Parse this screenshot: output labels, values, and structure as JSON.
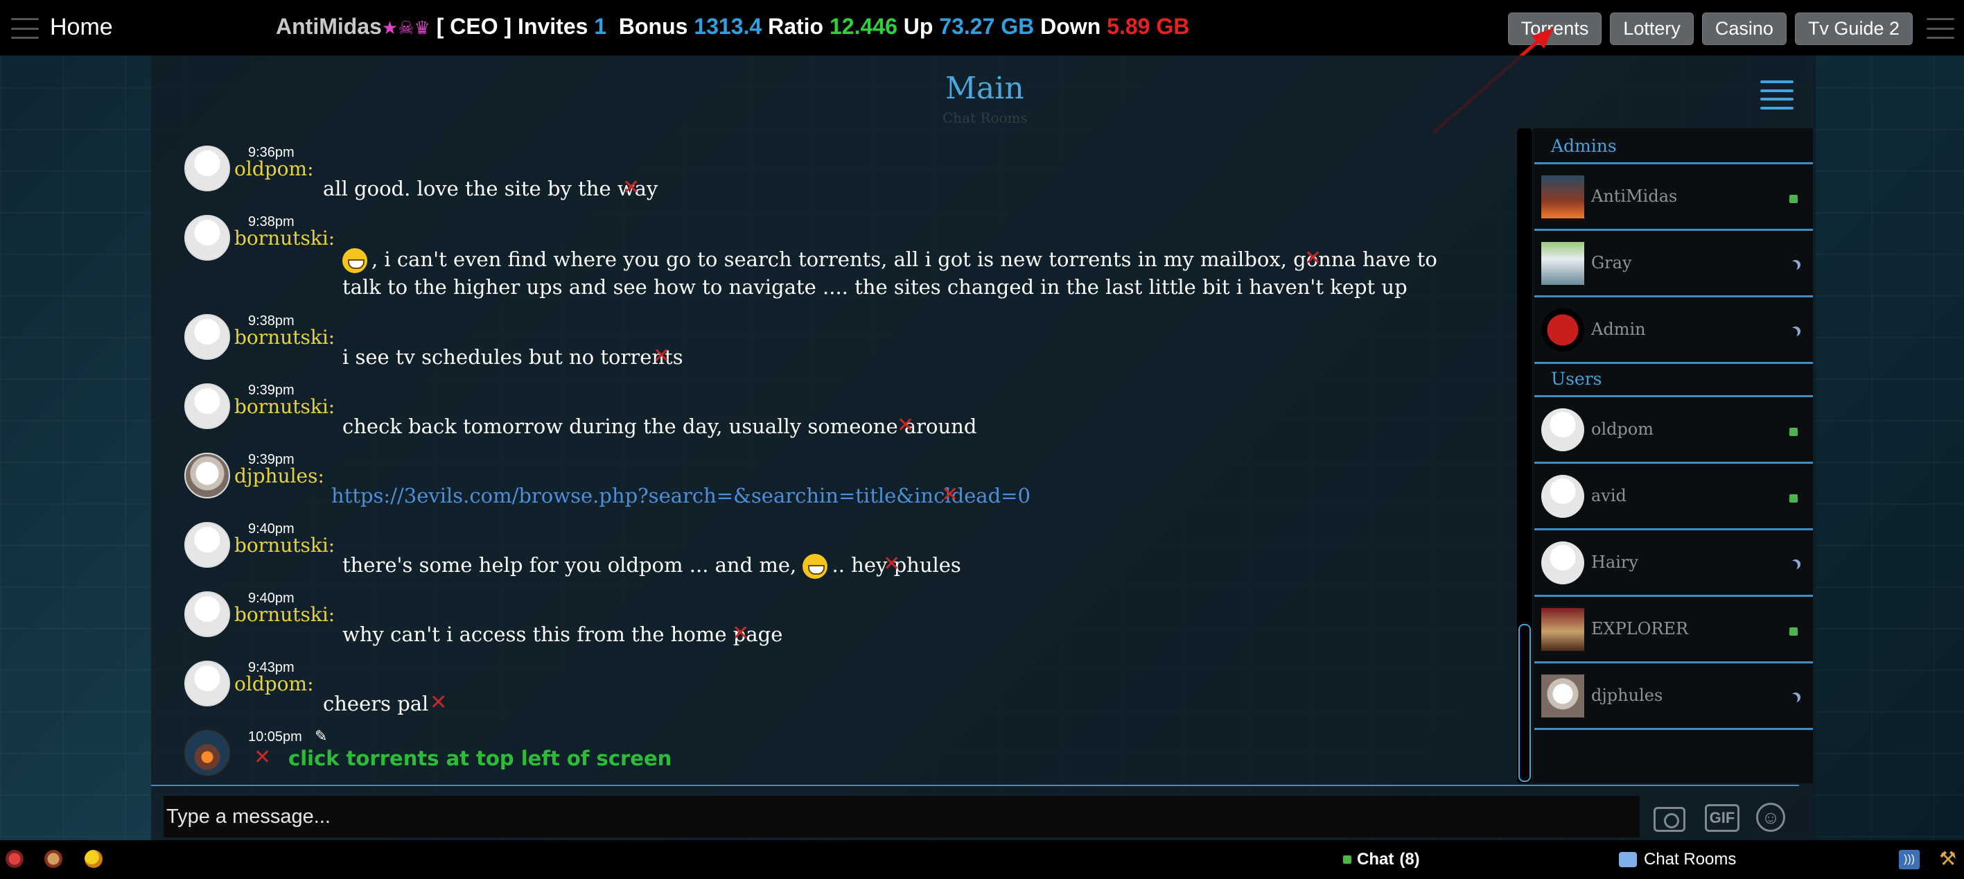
{
  "topbar": {
    "home_label": "Home",
    "username": "AntiMidas",
    "user_icons": "★☠♛",
    "class": "[ CEO ]",
    "invites_label": "Invites",
    "invites_value": "1",
    "bonus_label": "Bonus",
    "bonus_value": "1313.4",
    "ratio_label": "Ratio",
    "ratio_value": "12.446",
    "up_label": "Up",
    "up_value": "73.27 GB",
    "down_label": "Down",
    "down_value": "5.89 GB",
    "buttons": [
      "Torrents",
      "Lottery",
      "Casino",
      "Tv Guide 2"
    ]
  },
  "room": {
    "title": "Main",
    "subtitle": "Chat Rooms"
  },
  "messages": [
    {
      "time": "9:36pm",
      "user": "oldpom:",
      "text": "all good. love the site by the way"
    },
    {
      "time": "9:38pm",
      "user": "bornutski:",
      "text_line1": ", i can't even find where you go to search torrents, all i got is new torrents in my mailbox, gonna have to",
      "text_line2": "talk to the higher ups and see how to navigate .... the sites changed in the last little bit i haven't kept up"
    },
    {
      "time": "9:38pm",
      "user": "bornutski:",
      "text": "i see tv schedules but no torrents"
    },
    {
      "time": "9:39pm",
      "user": "bornutski:",
      "text": "check back tomorrow during the day, usually someone around"
    },
    {
      "time": "9:39pm",
      "user": "djphules:",
      "text": "https://3evils.com/browse.php?search=&searchin=title&incldead=0"
    },
    {
      "time": "9:40pm",
      "user": "bornutski:",
      "text_before": "there's some help for you oldpom ... and me,",
      "text_after": ".. hey phules"
    },
    {
      "time": "9:40pm",
      "user": "bornutski:",
      "text": "why can't i access this from the home page"
    },
    {
      "time": "9:43pm",
      "user": "oldpom:",
      "text": "cheers pal"
    },
    {
      "time": "10:05pm",
      "user": "",
      "text": "click torrents at top left of screen"
    }
  ],
  "sidebar": {
    "admins_heading": "Admins",
    "users_heading": "Users",
    "admins": [
      {
        "name": "AntiMidas",
        "status": "online"
      },
      {
        "name": "Gray",
        "status": "away"
      },
      {
        "name": "Admin",
        "status": "away"
      }
    ],
    "users": [
      {
        "name": "oldpom",
        "status": "online"
      },
      {
        "name": "avid",
        "status": "online"
      },
      {
        "name": "Hairy",
        "status": "away"
      },
      {
        "name": "EXPLORER",
        "status": "online"
      },
      {
        "name": "djphules",
        "status": "away"
      }
    ]
  },
  "input": {
    "placeholder": "Type a message...",
    "gif_label": "GIF"
  },
  "bottombar": {
    "chat_label": "Chat",
    "chat_count": "(8)",
    "rooms_label": "Chat Rooms"
  },
  "colors": {
    "accent": "#3fa4e0",
    "username": "#e8d33a",
    "delete": "#c92626",
    "bonus": "#2fa0e0",
    "ratio": "#2fd23a",
    "down": "#e82020",
    "online": "#4bb54b"
  }
}
